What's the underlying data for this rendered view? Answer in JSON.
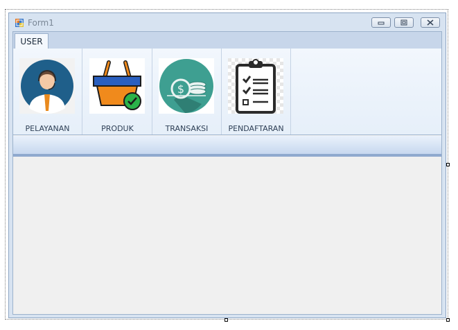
{
  "window": {
    "title": "Form1",
    "controls": [
      "minimize-icon",
      "restore-icon",
      "close-icon"
    ]
  },
  "tabs": [
    {
      "label": "USER",
      "selected": true
    }
  ],
  "ribbon": {
    "items": [
      {
        "label": "PELAYANAN",
        "icon": "customer-service-agent-icon"
      },
      {
        "label": "PRODUK",
        "icon": "shopping-basket-check-icon"
      },
      {
        "label": "TRANSAKSI",
        "icon": "money-coins-icon"
      },
      {
        "label": "PENDAFTARAN",
        "icon": "clipboard-checklist-icon"
      }
    ]
  },
  "colors": {
    "window_border": "#8ea6c4",
    "tab_strip": "#c7d6ea",
    "ribbon_bg": "#eef4fb",
    "separator": "#8fa9ce",
    "workspace": "#f0f0f0"
  }
}
